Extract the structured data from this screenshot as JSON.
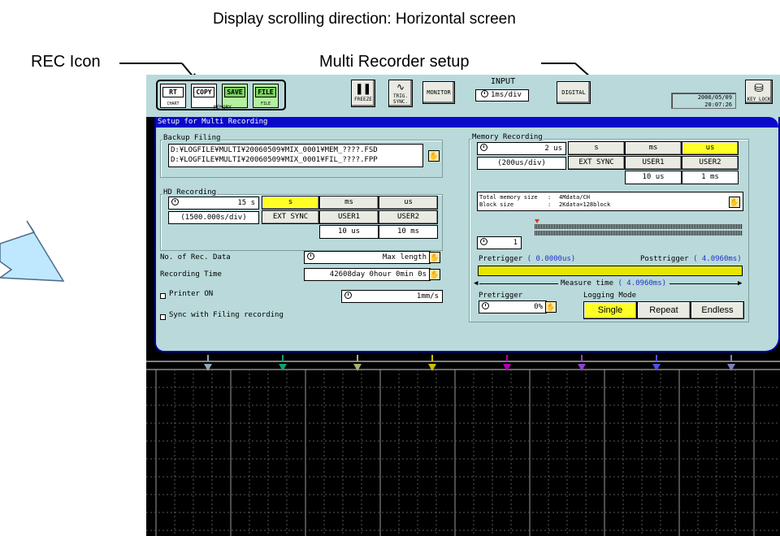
{
  "annotations": {
    "caption": "Display scrolling direction: Horizontal screen",
    "rec_icon": "REC Icon",
    "multi_setup": "Multi Recorder setup"
  },
  "topbar": {
    "rec_buttons": [
      {
        "main": "RT",
        "caption": "CHART"
      },
      {
        "main": "COPY",
        "caption": ""
      },
      {
        "main": "SAVE",
        "caption": ""
      },
      {
        "main": "FILE",
        "caption": "FILE"
      }
    ],
    "memory_caption": "MEMORY",
    "freeze_label": "FREEZE",
    "trig_label": "TRIG. SYNC.",
    "monitor_label": "MONITOR",
    "input_label": "INPUT",
    "input_value": "1ms/div",
    "digital_label": "DIGITAL",
    "date": "2006/05/09",
    "time": "20:07:26",
    "keylock_label": "KEY LOCK"
  },
  "panel": {
    "title": "Setup for Multi Recording",
    "backup": {
      "label": "Backup Filing",
      "line1": "D:¥LOGFILE¥MULTI¥20060509¥MIX_0001¥MEM_????.FSD",
      "line2": "D:¥LOGFILE¥MULTI¥20060509¥MIX_0001¥FIL_????.FPP"
    },
    "hd": {
      "label": "HD Recording",
      "value": "15 s",
      "per_div": "(1500.000s/div)",
      "units": [
        "s",
        "ms",
        "us"
      ],
      "selected_unit": "s",
      "ext_sync": "EXT SYNC",
      "user1": "USER1",
      "user2": "USER2",
      "user1_value": "10 us",
      "user2_value": "10 ms"
    },
    "rec_data": {
      "label": "No. of Rec. Data",
      "value": "Max length"
    },
    "rec_time": {
      "label": "Recording Time",
      "value": "42608day 0hour 0min 0s"
    },
    "printer": {
      "label": "Printer ON",
      "value": "1mm/s"
    },
    "sync": {
      "label": "Sync with Filing recording"
    },
    "memory": {
      "label": "Memory Recording",
      "value": "2 us",
      "per_div": "(200us/div)",
      "units": [
        "s",
        "ms",
        "us"
      ],
      "selected_unit": "us",
      "ext_sync": "EXT SYNC",
      "user1": "USER1",
      "user2": "USER2",
      "user1_value": "10 us",
      "user2_value": "1 ms",
      "total_size_label": "Total memory size",
      "total_size_value": "4Mdata/CH",
      "block_size_label": "Block size",
      "block_size_value": "2Kdata×128block",
      "block_index": "1",
      "pretrigger_label": "Pretrigger",
      "pretrigger_value": "( 0.0000us)",
      "posttrigger_label": "Posttrigger",
      "posttrigger_value": "( 4.0960ms)",
      "measure_label": "Measure time",
      "measure_value": "( 4.0960ms)"
    },
    "pretrigger": {
      "label": "Pretrigger",
      "value": "0%"
    },
    "logging": {
      "label": "Logging Mode",
      "modes": [
        "Single",
        "Repeat",
        "Endless"
      ],
      "selected": "Single"
    }
  },
  "colors": {
    "panel_bg": "#b9d9da",
    "title_bar": "#0a0ac8",
    "selected": "#ffff28",
    "trigger_bar": "#e6e600",
    "channel_markers": [
      "#8fa8b8",
      "#10a070",
      "#a8b070",
      "#c8c000",
      "#b000b0",
      "#9040d0",
      "#5050e0",
      "#8080c0"
    ]
  }
}
